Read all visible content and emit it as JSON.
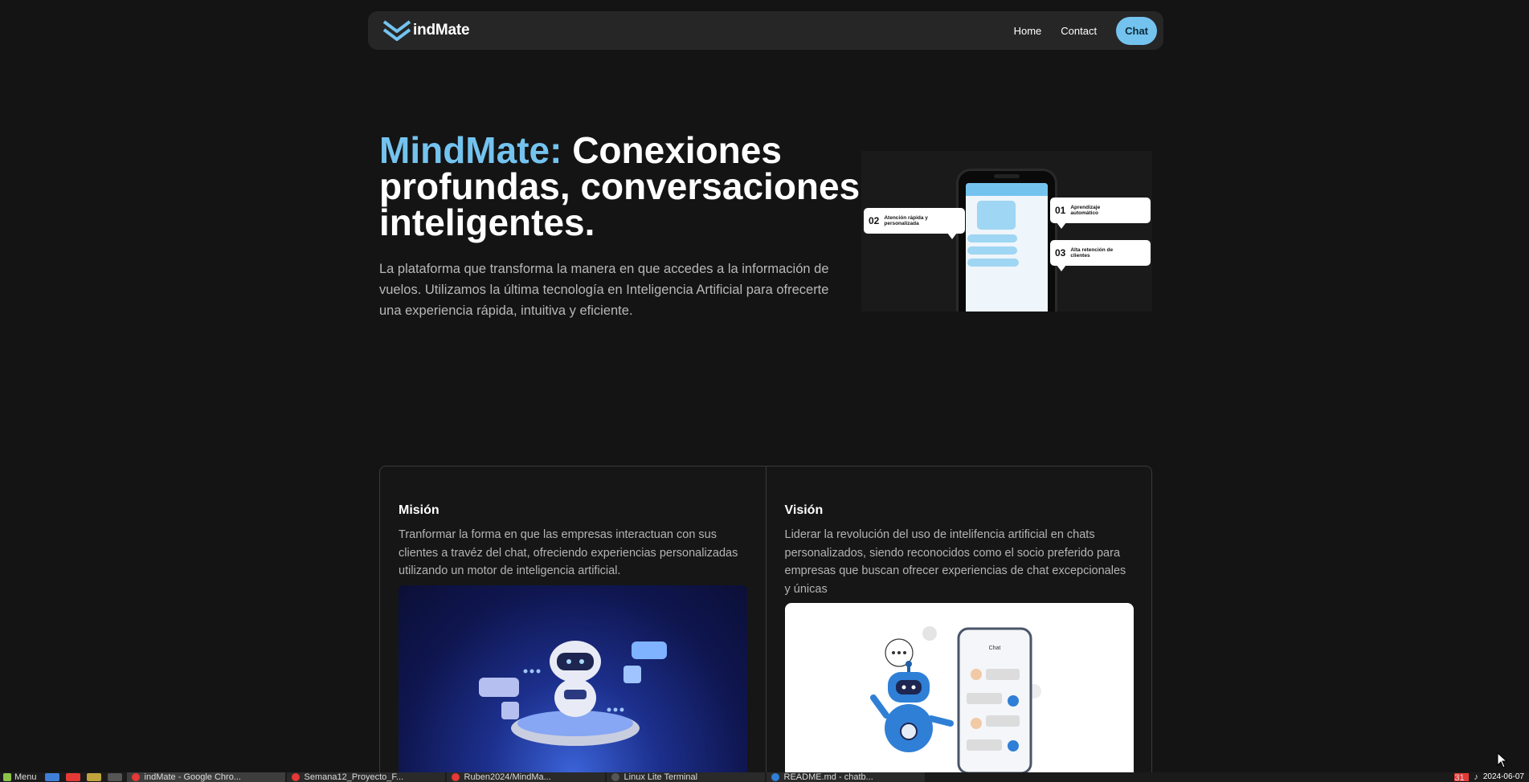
{
  "nav": {
    "brand": "indMate",
    "links": [
      "Home",
      "Contact"
    ],
    "chat_button": "Chat"
  },
  "hero": {
    "title_accent": "MindMate:",
    "title_rest": " Conexiones profundas, conversaciones inteligentes.",
    "description": "La plataforma que transforma la manera en que accedes a la información de vuelos. Utilizamos la última tecnología en Inteligencia Artificial para ofrecerte una experiencia rápida, intuitiva y eficiente.",
    "callouts": [
      {
        "num": "01",
        "label": "Aprendizaje automático"
      },
      {
        "num": "02",
        "label": "Atención rápida y personalizada"
      },
      {
        "num": "03",
        "label": "Alta retención de clientes"
      }
    ]
  },
  "mission": {
    "title": "Misión",
    "text": "Tranformar la forma en que las empresas interactuan con sus clientes a travéz del chat, ofreciendo experiencias personalizadas utilizando un motor de inteligencia artificial."
  },
  "vision": {
    "title": "Visión",
    "text": "Liderar la revolución del uso de intelifencia artificial en chats personalizados, siendo reconocidos como el socio preferido para empresas que buscan ofrecer experiencias de chat excepcionales y únicas",
    "phone_header": "Chat"
  },
  "taskbar": {
    "menu": "Menu",
    "tasks": [
      "indMate - Google Chro...",
      "Semana12_Proyecto_F...",
      "Ruben2024/MindMa...",
      "Linux Lite Terminal",
      "README.md - chatb..."
    ],
    "tray_badge": "31",
    "date": "2024-06-07"
  },
  "colors": {
    "accent": "#74c3ef",
    "background": "#141414",
    "nav_bg": "#262626"
  }
}
